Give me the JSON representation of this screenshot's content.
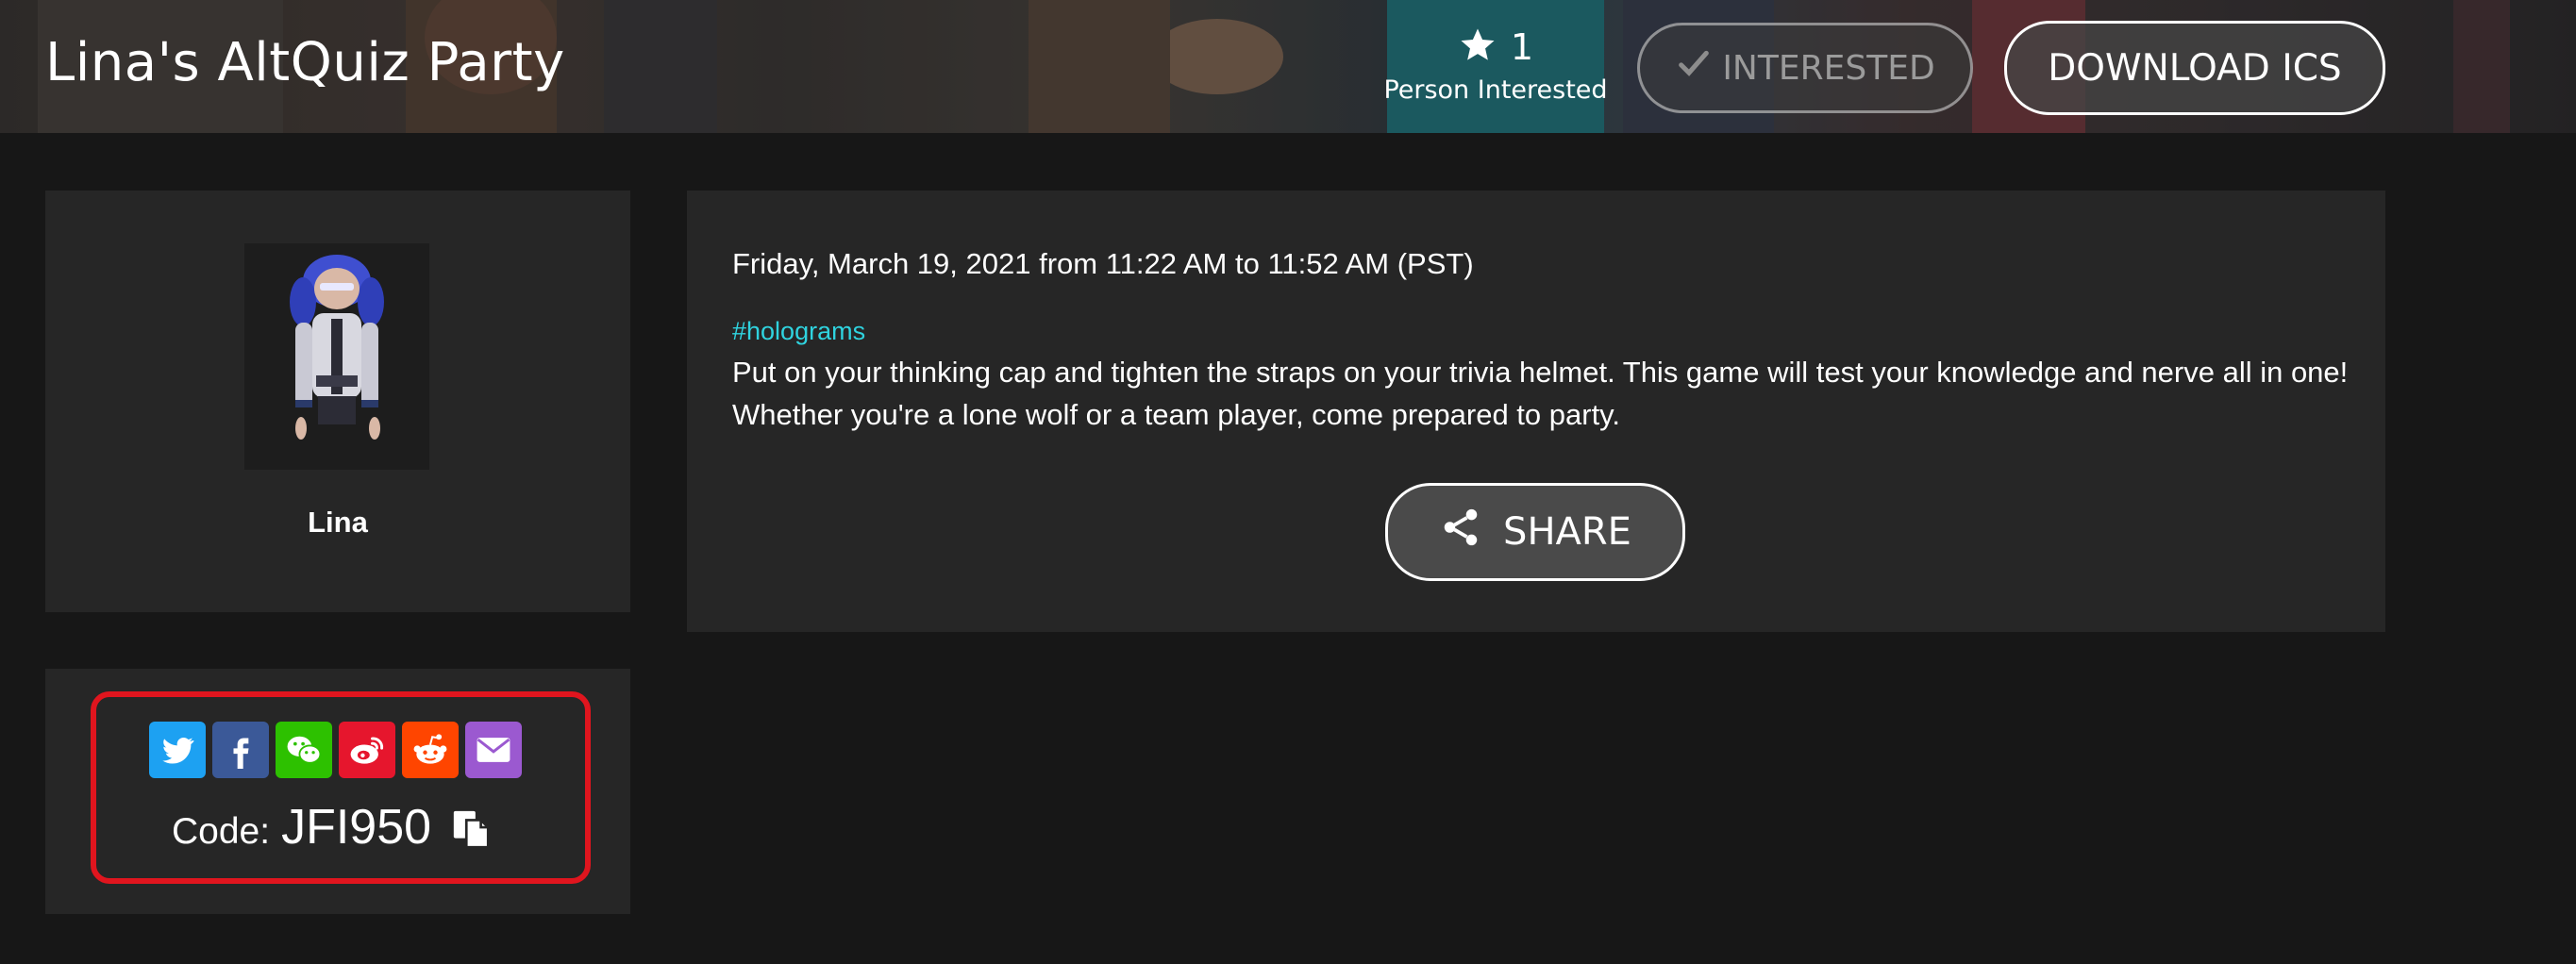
{
  "header": {
    "title": "Lina's AltQuiz Party",
    "interest_count": "1",
    "interest_label": "Person Interested",
    "interested_button": "INTERESTED",
    "download_button": "DOWNLOAD ICS"
  },
  "host": {
    "name": "Lina"
  },
  "event": {
    "date": "Friday, March 19, 2021 from 11:22 AM to 11:52 AM (PST)",
    "hashtag": "#holograms",
    "description": "Put on your thinking cap and tighten the straps on your trivia helmet. This game will test your knowledge and nerve all in one! Whether you're a lone wolf or a team player, come prepared to party.",
    "share_button": "SHARE"
  },
  "social": {
    "icons": [
      {
        "name": "twitter-icon",
        "color": "#1da1f2"
      },
      {
        "name": "facebook-icon",
        "color": "#3b5998"
      },
      {
        "name": "wechat-icon",
        "color": "#2dc100"
      },
      {
        "name": "weibo-icon",
        "color": "#e6162d"
      },
      {
        "name": "reddit-icon",
        "color": "#ff4500"
      },
      {
        "name": "email-icon",
        "color": "#9b59d0"
      }
    ],
    "code_label": "Code:",
    "code_value": "JFI950"
  },
  "colors": {
    "background": "#171717",
    "card": "#262626",
    "hashtag": "#2fd3df",
    "highlight": "#e0151e"
  }
}
